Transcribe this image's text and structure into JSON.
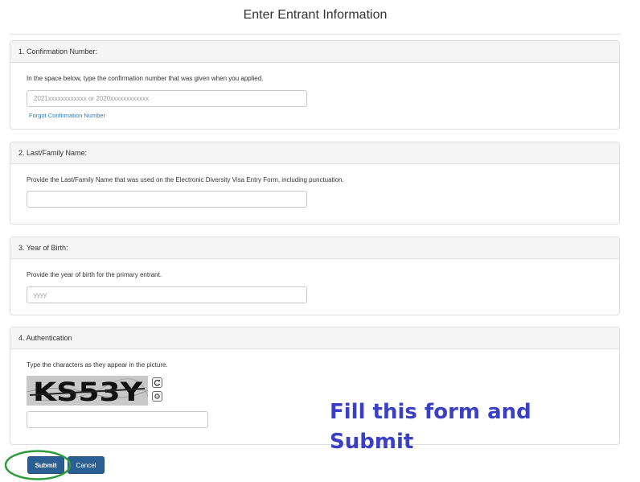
{
  "page": {
    "title": "Enter Entrant Information"
  },
  "sections": [
    {
      "heading": "1. Confirmation Number:",
      "description": "In the space below, type the confirmation number that was given when you applied.",
      "input_placeholder": "2021xxxxxxxxxxxx or 2020xxxxxxxxxxxx",
      "input_value": "",
      "link": "Forgot Confirmation Number"
    },
    {
      "heading": "2. Last/Family Name:",
      "description": "Provide the Last/Family Name that was used on the Electronic Diversity Visa Entry Form, including punctuation.",
      "input_placeholder": "",
      "input_value": ""
    },
    {
      "heading": "3. Year of Birth:",
      "description": "Provide the year of birth for the primary entrant.",
      "input_placeholder": "yyyy",
      "input_value": ""
    },
    {
      "heading": "4. Authentication",
      "description": "Type the characters as they appear in the picture.",
      "captcha_text": "KS53Y",
      "input_placeholder": "",
      "input_value": ""
    }
  ],
  "buttons": {
    "submit": "Submit",
    "cancel": "Cancel"
  },
  "icons": {
    "refresh": "refresh-icon",
    "audio": "audio-icon"
  },
  "annotation": {
    "instruction": "Fill this form and Submit",
    "highlight_color": "#2e9c3a",
    "text_color": "#3a3fc4"
  },
  "colors": {
    "primary_button": "#2a5f94",
    "link": "#337ab7",
    "panel_heading_bg": "#f5f5f5"
  }
}
